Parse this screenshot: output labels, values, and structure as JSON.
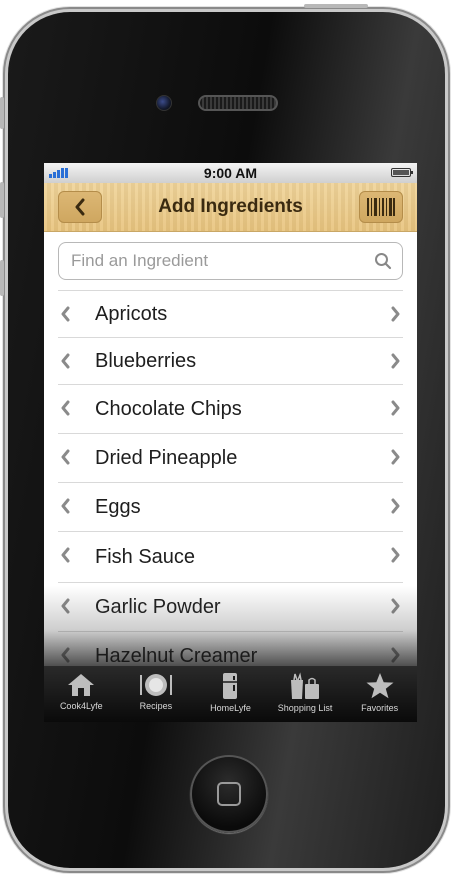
{
  "status_bar": {
    "time": "9:00 AM"
  },
  "nav": {
    "title": "Add Ingredients"
  },
  "search": {
    "placeholder": "Find an Ingredient"
  },
  "ingredients": [
    "Apricots",
    "Blueberries",
    "Chocolate Chips",
    "Dried Pineapple",
    "Eggs",
    "Fish Sauce",
    "Garlic Powder",
    "Hazelnut Creamer"
  ],
  "tabs": [
    {
      "label": "Cook4Lyfe",
      "icon": "house-icon"
    },
    {
      "label": "Recipes",
      "icon": "plate-icon"
    },
    {
      "label": "HomeLyfe",
      "icon": "fridge-icon"
    },
    {
      "label": "Shopping List",
      "icon": "grocery-bag-icon"
    },
    {
      "label": "Favorites",
      "icon": "star-icon"
    }
  ],
  "colors": {
    "nav_wood": "#e8c47e",
    "signal_blue": "#2a6fd6",
    "tab_bar": "#0a0a0a"
  }
}
